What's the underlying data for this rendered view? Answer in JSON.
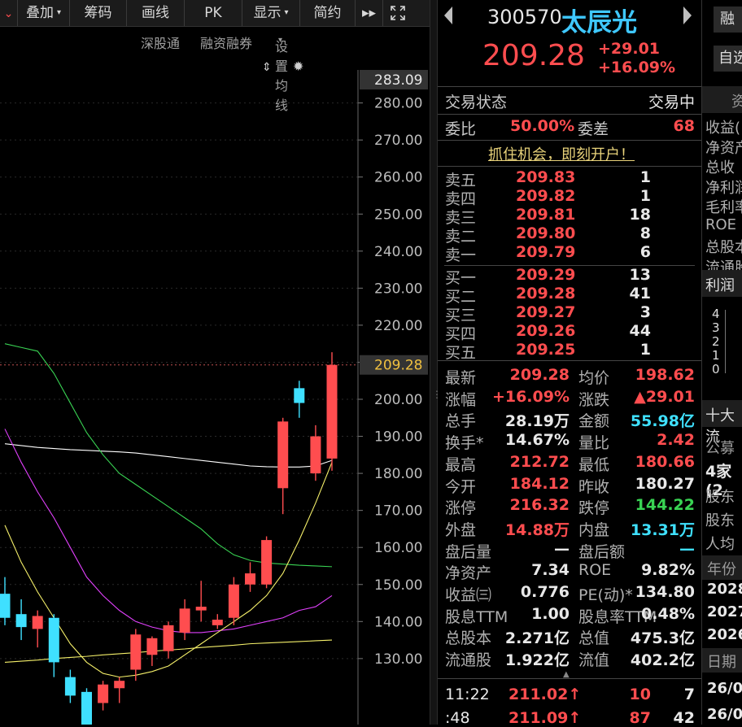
{
  "toolbar": {
    "items": [
      {
        "label": "叠加",
        "dropdown": true
      },
      {
        "label": "筹码",
        "dropdown": false
      },
      {
        "label": "画线",
        "dropdown": false
      },
      {
        "label": "PK",
        "dropdown": false
      },
      {
        "label": "显示",
        "dropdown": true
      },
      {
        "label": "简约",
        "dropdown": false
      }
    ],
    "forward_icon": "fast-forward-icon",
    "fullscreen_icon": "expand-icon"
  },
  "subbar": {
    "exchange": "深股通",
    "margin": "融资融券",
    "ma_setting": "设置均线"
  },
  "chart_data": {
    "type": "candlestick",
    "price_ticks": [
      "280.00",
      "270.00",
      "260.00",
      "250.00",
      "240.00",
      "230.00",
      "220.00",
      "210.00",
      "200.00",
      "190.00",
      "180.00",
      "170.00",
      "160.00",
      "150.00",
      "140.00",
      "130.00"
    ],
    "top_label": "283.09",
    "last_price_label": "209.28",
    "last_price": 209.28,
    "ylim": [
      125,
      286
    ],
    "candles": [
      {
        "o": 147.5,
        "h": 152,
        "l": 139,
        "c": 141.0
      },
      {
        "o": 142,
        "h": 146,
        "l": 135,
        "c": 138.5
      },
      {
        "o": 138,
        "h": 143,
        "l": 133,
        "c": 141.5
      },
      {
        "o": 141,
        "h": 142,
        "l": 125,
        "c": 129.0
      },
      {
        "o": 125,
        "h": 127,
        "l": 118,
        "c": 120.0
      },
      {
        "o": 121,
        "h": 122,
        "l": 110,
        "c": 112.0
      },
      {
        "o": 118,
        "h": 124,
        "l": 116,
        "c": 123.0
      },
      {
        "o": 122,
        "h": 125,
        "l": 118,
        "c": 124.0
      },
      {
        "o": 127,
        "h": 138,
        "l": 124,
        "c": 136.5
      },
      {
        "o": 131,
        "h": 136,
        "l": 128,
        "c": 135.5
      },
      {
        "o": 132,
        "h": 140,
        "l": 130,
        "c": 139.0
      },
      {
        "o": 137,
        "h": 146,
        "l": 135,
        "c": 143.5
      },
      {
        "o": 143,
        "h": 151,
        "l": 140,
        "c": 144.0
      },
      {
        "o": 139,
        "h": 142,
        "l": 138,
        "c": 140.5
      },
      {
        "o": 141,
        "h": 152,
        "l": 139,
        "c": 150.0
      },
      {
        "o": 150,
        "h": 156,
        "l": 148,
        "c": 153.0
      },
      {
        "o": 150,
        "h": 163,
        "l": 149,
        "c": 162.0
      },
      {
        "o": 176,
        "h": 195,
        "l": 169,
        "c": 194.0
      },
      {
        "o": 203,
        "h": 205,
        "l": 195,
        "c": 199.0
      },
      {
        "o": 180,
        "h": 193,
        "l": 178,
        "c": 190.0
      },
      {
        "o": 184,
        "h": 212.7,
        "l": 180.7,
        "c": 209.28
      }
    ],
    "ma_lines": [
      {
        "color": "#ffffff",
        "values": [
          188,
          187.5,
          187,
          186.7,
          186.4,
          186.2,
          186,
          185.8,
          185.5,
          185,
          184.5,
          184,
          183.5,
          183,
          182.5,
          182,
          181.8,
          181.7,
          181.7,
          182,
          183.5
        ]
      },
      {
        "color": "#39d353",
        "values": [
          215,
          214,
          213,
          207,
          199,
          191,
          185,
          180,
          177,
          174,
          171,
          168,
          165,
          161,
          158,
          156.5,
          155.8,
          155.5,
          155.2,
          155,
          154.8
        ]
      },
      {
        "color": "#e040fb",
        "values": [
          192,
          183,
          175,
          168,
          160,
          152,
          147,
          143,
          140,
          138.5,
          137.5,
          137,
          137,
          137.5,
          138,
          139,
          140,
          141,
          143,
          144,
          147
        ]
      },
      {
        "color": "#f5f06a",
        "values": [
          166,
          156,
          148,
          141,
          134,
          129,
          126,
          125,
          125.5,
          126.5,
          128,
          131,
          134,
          137,
          140,
          143,
          147,
          153,
          162,
          172,
          183
        ]
      },
      {
        "color": "#f5f06a",
        "values": [
          129,
          129.3,
          129.6,
          130,
          130.3,
          130.6,
          131,
          131.3,
          131.6,
          132,
          132.3,
          132.6,
          133,
          133.3,
          133.6,
          134,
          134.2,
          134.4,
          134.6,
          134.8,
          135
        ]
      }
    ]
  },
  "quote": {
    "code": "300570",
    "name": "太辰光",
    "price": "209.28",
    "change": "+29.01",
    "change_pct": "+16.09%",
    "status_label": "交易状态",
    "status_value": "交易中",
    "weibi_label": "委比",
    "weibi_value": "50.00%",
    "weicha_label": "委差",
    "weicha_value": "68",
    "promo": "抓住机会，即刻开户！",
    "asks": [
      {
        "label": "卖五",
        "price": "209.83",
        "vol": "1"
      },
      {
        "label": "卖四",
        "price": "209.82",
        "vol": "1"
      },
      {
        "label": "卖三",
        "price": "209.81",
        "vol": "18"
      },
      {
        "label": "卖二",
        "price": "209.80",
        "vol": "8"
      },
      {
        "label": "卖一",
        "price": "209.79",
        "vol": "6"
      }
    ],
    "bids": [
      {
        "label": "买一",
        "price": "209.29",
        "vol": "13"
      },
      {
        "label": "买二",
        "price": "209.28",
        "vol": "41"
      },
      {
        "label": "买三",
        "price": "209.27",
        "vol": "3"
      },
      {
        "label": "买四",
        "price": "209.26",
        "vol": "44"
      },
      {
        "label": "买五",
        "price": "209.25",
        "vol": "1"
      }
    ],
    "stats": [
      {
        "l1": "最新",
        "v1": "209.28",
        "c1": "red",
        "l2": "均价",
        "v2": "198.62",
        "c2": "red"
      },
      {
        "l1": "涨幅",
        "v1": "+16.09%",
        "c1": "red",
        "l2": "涨跌",
        "v2": "▲29.01",
        "c2": "red"
      },
      {
        "l1": "总手",
        "v1": "28.19万",
        "c1": "white",
        "l2": "金额",
        "v2": "55.98亿",
        "c2": "cyan"
      },
      {
        "l1": "换手*",
        "v1": "14.67%",
        "c1": "white",
        "l2": "量比",
        "v2": "2.42",
        "c2": "red"
      },
      {
        "l1": "最高",
        "v1": "212.72",
        "c1": "red",
        "l2": "最低",
        "v2": "180.66",
        "c2": "red"
      },
      {
        "l1": "今开",
        "v1": "184.12",
        "c1": "red",
        "l2": "昨收",
        "v2": "180.27",
        "c2": "white"
      },
      {
        "l1": "涨停",
        "v1": "216.32",
        "c1": "red",
        "l2": "跌停",
        "v2": "144.22",
        "c2": "green"
      },
      {
        "l1": "外盘",
        "v1": "14.88万",
        "c1": "red",
        "l2": "内盘",
        "v2": "13.31万",
        "c2": "cyan"
      },
      {
        "l1": "盘后量",
        "v1": "—",
        "c1": "white",
        "l2": "盘后额",
        "v2": "—",
        "c2": "cyan"
      },
      {
        "l1": "净资产",
        "v1": "7.34",
        "c1": "white",
        "l2": "ROE",
        "v2": "9.82%",
        "c2": "white"
      },
      {
        "l1": "收益㈢",
        "v1": "0.776",
        "c1": "white",
        "l2": "PE(动)*",
        "v2": "134.80",
        "c2": "white"
      },
      {
        "l1": "股息TTM",
        "v1": "1.00",
        "c1": "white",
        "l2": "股息率TTM",
        "v2": "0.48%",
        "c2": "white"
      },
      {
        "l1": "总股本",
        "v1": "2.271亿",
        "c1": "white",
        "l2": "总值",
        "v2": "475.3亿",
        "c2": "white"
      },
      {
        "l1": "流通股",
        "v1": "1.922亿",
        "c1": "white",
        "l2": "流值",
        "v2": "402.2亿",
        "c2": "white"
      }
    ],
    "ticks": [
      {
        "time": "11:22",
        "price": "211.02",
        "vol": "10",
        "count": "7"
      },
      {
        "time": ":48",
        "price": "211.09",
        "vol": "87",
        "count": "42"
      }
    ]
  },
  "side": {
    "top_button": "融",
    "second_button": "自选",
    "tab": "资",
    "labels": [
      "收益(",
      "净资产",
      "总收",
      "净利润",
      "毛利率",
      "ROE",
      "总股本",
      "流通股"
    ],
    "profit_label": "利润",
    "mini_axis": [
      "4",
      "3",
      "2",
      "1",
      "0"
    ],
    "holders_label": "十大流",
    "fund_label": "公募",
    "fund_value": "4家(2",
    "holder_labels": [
      "股东",
      "股东",
      "人均"
    ],
    "year_label": "年份",
    "years": [
      "2028",
      "2027",
      "2026"
    ],
    "date_label": "日期",
    "dates": [
      "26/0",
      "26/0"
    ]
  },
  "colors": {
    "up": "#ff4d4f",
    "down": "#3fe0ff",
    "name": "#3fc8ff"
  }
}
